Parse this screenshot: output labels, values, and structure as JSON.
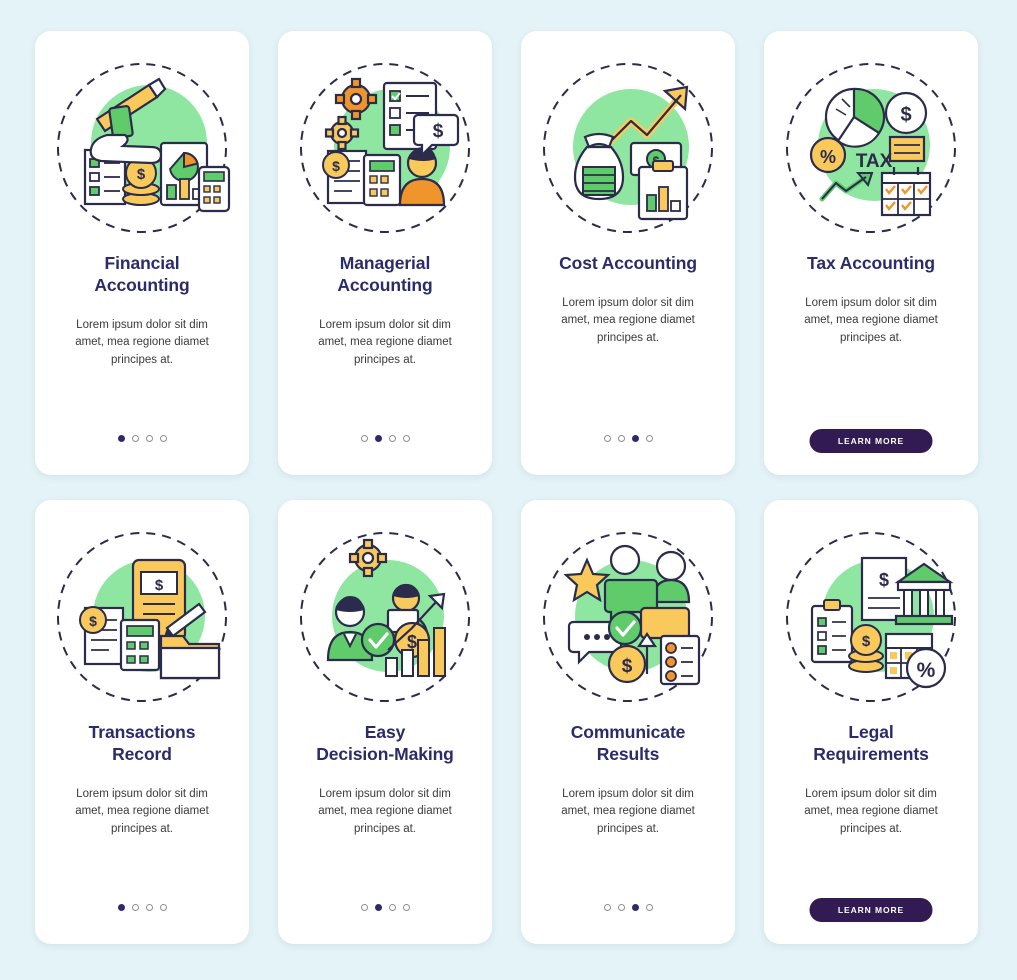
{
  "page": {
    "background_color": "#e3f3f7",
    "card_background": "#ffffff",
    "title_color": "#2b2b6b",
    "button_color": "#321a52",
    "accent_green": "#5fcb6b",
    "accent_yellow": "#f9c95c",
    "accent_orange": "#f0952c",
    "lorem": "Lorem ipsum dolor sit dim amet, mea regione diamet principes at."
  },
  "cards": [
    {
      "id": "financial-accounting",
      "title": "Financial Accounting",
      "title_lines": [
        "Financial",
        "Accounting"
      ],
      "description": "Lorem ipsum dolor sit dim amet, mea regione diamet principes at.",
      "illustration": "hand-writing-documents-chart-icon",
      "footer_type": "dots",
      "dots": {
        "count": 4,
        "active_index": 0
      },
      "button_label": null
    },
    {
      "id": "managerial-accounting",
      "title": "Managerial Accounting",
      "title_lines": [
        "Managerial",
        "Accounting"
      ],
      "description": "Lorem ipsum dolor sit dim amet, mea regione diamet principes at.",
      "illustration": "gears-checklist-person-icon",
      "footer_type": "dots",
      "dots": {
        "count": 4,
        "active_index": 1
      },
      "button_label": null
    },
    {
      "id": "cost-accounting",
      "title": "Cost Accounting",
      "title_lines": [
        "Cost Accounting"
      ],
      "description": "Lorem ipsum dolor sit dim amet, mea regione diamet principes at.",
      "illustration": "money-bag-growth-arrow-clipboard-icon",
      "footer_type": "dots",
      "dots": {
        "count": 4,
        "active_index": 2
      },
      "button_label": null
    },
    {
      "id": "tax-accounting",
      "title": "Tax Accounting",
      "title_lines": [
        "Tax Accounting"
      ],
      "description": "Lorem ipsum dolor sit dim amet, mea regione diamet principes at.",
      "illustration": "pie-chart-tax-percent-calendar-icon",
      "footer_type": "button",
      "dots": null,
      "button_label": "LEARN MORE"
    },
    {
      "id": "transactions-record",
      "title": "Transactions Record",
      "title_lines": [
        "Transactions",
        "Record"
      ],
      "description": "Lorem ipsum dolor sit dim amet, mea regione diamet principes at.",
      "illustration": "mobile-payment-folder-documents-icon",
      "footer_type": "dots",
      "dots": {
        "count": 4,
        "active_index": 0
      },
      "button_label": null
    },
    {
      "id": "easy-decision-making",
      "title": "Easy Decision-Making",
      "title_lines": [
        "Easy",
        "Decision-Making"
      ],
      "description": "Lorem ipsum dolor sit dim amet, mea regione diamet principes at.",
      "illustration": "people-checkmark-growth-chart-icon",
      "footer_type": "dots",
      "dots": {
        "count": 4,
        "active_index": 1
      },
      "button_label": null
    },
    {
      "id": "communicate-results",
      "title": "Communicate Results",
      "title_lines": [
        "Communicate",
        "Results"
      ],
      "description": "Lorem ipsum dolor sit dim amet, mea regione diamet principes at.",
      "illustration": "speech-bubbles-star-checklist-icon",
      "footer_type": "dots",
      "dots": {
        "count": 4,
        "active_index": 2
      },
      "button_label": null
    },
    {
      "id": "legal-requirements",
      "title": "Legal Requirements",
      "title_lines": [
        "Legal",
        "Requirements"
      ],
      "description": "Lorem ipsum dolor sit dim amet, mea regione diamet principes at.",
      "illustration": "bank-building-clipboard-percent-icon",
      "footer_type": "button",
      "dots": null,
      "button_label": "LEARN MORE"
    }
  ]
}
